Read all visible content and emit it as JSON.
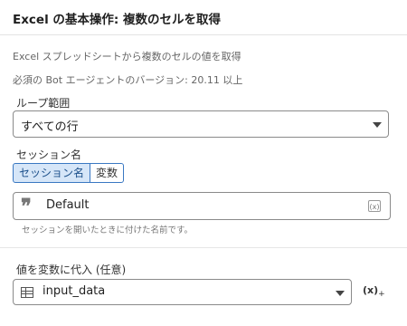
{
  "header": {
    "title": "Excel の基本操作: 複数のセルを取得"
  },
  "description": {
    "line1": "Excel スプレッドシートから複数のセルの値を取得",
    "line2": "必須の Bot エージェントのバージョン: 20.11 以上"
  },
  "loop_range": {
    "label": "ループ範囲",
    "selected": "すべての行"
  },
  "session": {
    "label": "セッション名",
    "toggle": {
      "option_session": "セッション名",
      "option_variable": "変数",
      "active": "option_session"
    },
    "value": "Default",
    "hint": "セッションを開いたときに付けた名前です。",
    "var_icon_text": "(x)"
  },
  "assign": {
    "label": "値を変数に代入 (任意)",
    "selected": "input_data",
    "add_icon_text": "(x)",
    "add_icon_plus": "+"
  },
  "icons": {
    "quote": "quote-icon",
    "variable": "variable-icon",
    "table": "table-icon",
    "add_variable": "add-variable-icon",
    "dropdown": "chevron-down-icon"
  },
  "colors": {
    "accent": "#3a78c2",
    "toggle_active_bg": "#d6e6f8"
  }
}
